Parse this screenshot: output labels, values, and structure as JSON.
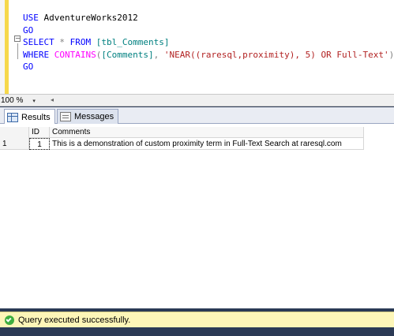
{
  "editor": {
    "lines": {
      "l1": {
        "kw": "USE",
        "rest": " AdventureWorks2012"
      },
      "l2": {
        "kw": "GO"
      },
      "l3": {
        "kw1": "SELECT",
        "gray1": " * ",
        "kw2": "FROM",
        "ident": " [tbl_Comments]"
      },
      "l4": {
        "kw1": "WHERE",
        "fn": " CONTAINS",
        "gray1": "(",
        "ident": "[Comments]",
        "gray2": ", ",
        "str": "'NEAR((raresql,proximity), 5) OR Full-Text'",
        "gray3": ")"
      },
      "l5": {
        "kw": "GO"
      }
    },
    "collapse_symbol": "−"
  },
  "zoom": {
    "value": "100 %",
    "caret": "▾",
    "scroll_left": "◂"
  },
  "tabs": [
    {
      "label": "Results",
      "icon": "results-grid-icon",
      "active": true
    },
    {
      "label": "Messages",
      "icon": "messages-icon",
      "active": false
    }
  ],
  "results": {
    "columns": [
      "ID",
      "Comments"
    ],
    "rows": [
      {
        "rownum": "1",
        "id": "1",
        "comments": "This is a demonstration of custom proximity term in Full-Text Search at raresql.com"
      }
    ]
  },
  "status": {
    "text": "Query executed successfully.",
    "icon": "success-check-icon",
    "color": "#fdf6b8"
  }
}
